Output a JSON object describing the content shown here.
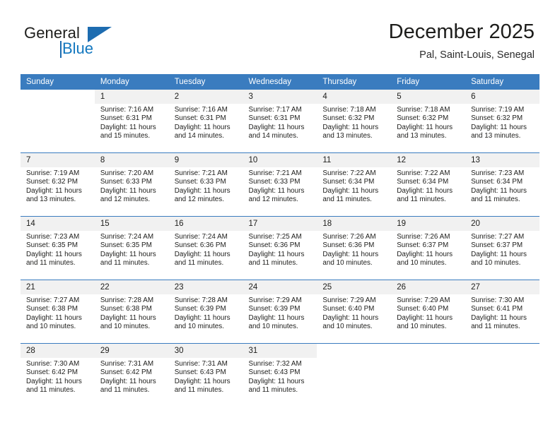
{
  "brand": {
    "name_part1": "General",
    "name_part2": "Blue"
  },
  "header": {
    "title": "December 2025",
    "location": "Pal, Saint-Louis, Senegal"
  },
  "colors": {
    "header_blue": "#3a7cbf",
    "brand_blue": "#1277bf",
    "cell_number_bg": "#f1f1f1",
    "text": "#1d1d1b"
  },
  "weekdays": [
    "Sunday",
    "Monday",
    "Tuesday",
    "Wednesday",
    "Thursday",
    "Friday",
    "Saturday"
  ],
  "labels": {
    "sunrise_prefix": "Sunrise:",
    "sunset_prefix": "Sunset:",
    "daylight_prefix": "Daylight:"
  },
  "weeks": [
    [
      {
        "day": "",
        "sunrise": "",
        "sunset": "",
        "daylight": ""
      },
      {
        "day": "1",
        "sunrise": "Sunrise: 7:16 AM",
        "sunset": "Sunset: 6:31 PM",
        "daylight": "Daylight: 11 hours and 15 minutes."
      },
      {
        "day": "2",
        "sunrise": "Sunrise: 7:16 AM",
        "sunset": "Sunset: 6:31 PM",
        "daylight": "Daylight: 11 hours and 14 minutes."
      },
      {
        "day": "3",
        "sunrise": "Sunrise: 7:17 AM",
        "sunset": "Sunset: 6:31 PM",
        "daylight": "Daylight: 11 hours and 14 minutes."
      },
      {
        "day": "4",
        "sunrise": "Sunrise: 7:18 AM",
        "sunset": "Sunset: 6:32 PM",
        "daylight": "Daylight: 11 hours and 13 minutes."
      },
      {
        "day": "5",
        "sunrise": "Sunrise: 7:18 AM",
        "sunset": "Sunset: 6:32 PM",
        "daylight": "Daylight: 11 hours and 13 minutes."
      },
      {
        "day": "6",
        "sunrise": "Sunrise: 7:19 AM",
        "sunset": "Sunset: 6:32 PM",
        "daylight": "Daylight: 11 hours and 13 minutes."
      }
    ],
    [
      {
        "day": "7",
        "sunrise": "Sunrise: 7:19 AM",
        "sunset": "Sunset: 6:32 PM",
        "daylight": "Daylight: 11 hours and 13 minutes."
      },
      {
        "day": "8",
        "sunrise": "Sunrise: 7:20 AM",
        "sunset": "Sunset: 6:33 PM",
        "daylight": "Daylight: 11 hours and 12 minutes."
      },
      {
        "day": "9",
        "sunrise": "Sunrise: 7:21 AM",
        "sunset": "Sunset: 6:33 PM",
        "daylight": "Daylight: 11 hours and 12 minutes."
      },
      {
        "day": "10",
        "sunrise": "Sunrise: 7:21 AM",
        "sunset": "Sunset: 6:33 PM",
        "daylight": "Daylight: 11 hours and 12 minutes."
      },
      {
        "day": "11",
        "sunrise": "Sunrise: 7:22 AM",
        "sunset": "Sunset: 6:34 PM",
        "daylight": "Daylight: 11 hours and 11 minutes."
      },
      {
        "day": "12",
        "sunrise": "Sunrise: 7:22 AM",
        "sunset": "Sunset: 6:34 PM",
        "daylight": "Daylight: 11 hours and 11 minutes."
      },
      {
        "day": "13",
        "sunrise": "Sunrise: 7:23 AM",
        "sunset": "Sunset: 6:34 PM",
        "daylight": "Daylight: 11 hours and 11 minutes."
      }
    ],
    [
      {
        "day": "14",
        "sunrise": "Sunrise: 7:23 AM",
        "sunset": "Sunset: 6:35 PM",
        "daylight": "Daylight: 11 hours and 11 minutes."
      },
      {
        "day": "15",
        "sunrise": "Sunrise: 7:24 AM",
        "sunset": "Sunset: 6:35 PM",
        "daylight": "Daylight: 11 hours and 11 minutes."
      },
      {
        "day": "16",
        "sunrise": "Sunrise: 7:24 AM",
        "sunset": "Sunset: 6:36 PM",
        "daylight": "Daylight: 11 hours and 11 minutes."
      },
      {
        "day": "17",
        "sunrise": "Sunrise: 7:25 AM",
        "sunset": "Sunset: 6:36 PM",
        "daylight": "Daylight: 11 hours and 11 minutes."
      },
      {
        "day": "18",
        "sunrise": "Sunrise: 7:26 AM",
        "sunset": "Sunset: 6:36 PM",
        "daylight": "Daylight: 11 hours and 10 minutes."
      },
      {
        "day": "19",
        "sunrise": "Sunrise: 7:26 AM",
        "sunset": "Sunset: 6:37 PM",
        "daylight": "Daylight: 11 hours and 10 minutes."
      },
      {
        "day": "20",
        "sunrise": "Sunrise: 7:27 AM",
        "sunset": "Sunset: 6:37 PM",
        "daylight": "Daylight: 11 hours and 10 minutes."
      }
    ],
    [
      {
        "day": "21",
        "sunrise": "Sunrise: 7:27 AM",
        "sunset": "Sunset: 6:38 PM",
        "daylight": "Daylight: 11 hours and 10 minutes."
      },
      {
        "day": "22",
        "sunrise": "Sunrise: 7:28 AM",
        "sunset": "Sunset: 6:38 PM",
        "daylight": "Daylight: 11 hours and 10 minutes."
      },
      {
        "day": "23",
        "sunrise": "Sunrise: 7:28 AM",
        "sunset": "Sunset: 6:39 PM",
        "daylight": "Daylight: 11 hours and 10 minutes."
      },
      {
        "day": "24",
        "sunrise": "Sunrise: 7:29 AM",
        "sunset": "Sunset: 6:39 PM",
        "daylight": "Daylight: 11 hours and 10 minutes."
      },
      {
        "day": "25",
        "sunrise": "Sunrise: 7:29 AM",
        "sunset": "Sunset: 6:40 PM",
        "daylight": "Daylight: 11 hours and 10 minutes."
      },
      {
        "day": "26",
        "sunrise": "Sunrise: 7:29 AM",
        "sunset": "Sunset: 6:40 PM",
        "daylight": "Daylight: 11 hours and 10 minutes."
      },
      {
        "day": "27",
        "sunrise": "Sunrise: 7:30 AM",
        "sunset": "Sunset: 6:41 PM",
        "daylight": "Daylight: 11 hours and 11 minutes."
      }
    ],
    [
      {
        "day": "28",
        "sunrise": "Sunrise: 7:30 AM",
        "sunset": "Sunset: 6:42 PM",
        "daylight": "Daylight: 11 hours and 11 minutes."
      },
      {
        "day": "29",
        "sunrise": "Sunrise: 7:31 AM",
        "sunset": "Sunset: 6:42 PM",
        "daylight": "Daylight: 11 hours and 11 minutes."
      },
      {
        "day": "30",
        "sunrise": "Sunrise: 7:31 AM",
        "sunset": "Sunset: 6:43 PM",
        "daylight": "Daylight: 11 hours and 11 minutes."
      },
      {
        "day": "31",
        "sunrise": "Sunrise: 7:32 AM",
        "sunset": "Sunset: 6:43 PM",
        "daylight": "Daylight: 11 hours and 11 minutes."
      },
      {
        "day": "",
        "sunrise": "",
        "sunset": "",
        "daylight": ""
      },
      {
        "day": "",
        "sunrise": "",
        "sunset": "",
        "daylight": ""
      },
      {
        "day": "",
        "sunrise": "",
        "sunset": "",
        "daylight": ""
      }
    ]
  ]
}
